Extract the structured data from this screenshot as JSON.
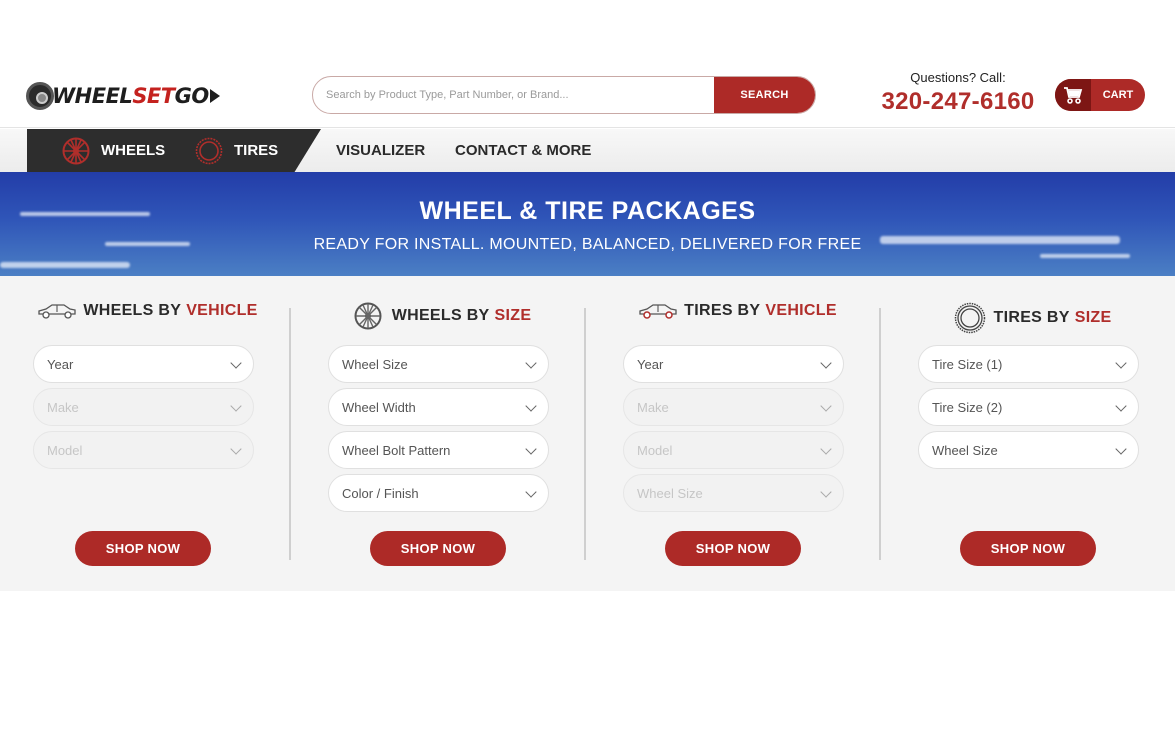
{
  "header": {
    "logo": {
      "part1": "WHEEL",
      "part2": "SET",
      "part3": "GO"
    },
    "search": {
      "placeholder": "Search by Product Type, Part Number, or Brand...",
      "button_label": "SEARCH"
    },
    "contact": {
      "question": "Questions? Call:",
      "phone": "320-247-6160"
    },
    "cart": {
      "label": "CART",
      "icon": "cart-icon"
    }
  },
  "nav": {
    "items": [
      {
        "label": "WHEELS",
        "icon": "wheel-icon"
      },
      {
        "label": "TIRES",
        "icon": "tire-icon"
      },
      {
        "label": "VISUALIZER"
      },
      {
        "label": "CONTACT & MORE"
      }
    ]
  },
  "hero": {
    "title": "WHEEL & TIRE PACKAGES",
    "subtitle": "READY FOR INSTALL. MOUNTED, BALANCED, DELIVERED FOR FREE"
  },
  "finder": {
    "columns": [
      {
        "title_main": "WHEELS BY",
        "title_accent": "VEHICLE",
        "icon": "car-icon",
        "selects": [
          {
            "label": "Year",
            "disabled": false
          },
          {
            "label": "Make",
            "disabled": true
          },
          {
            "label": "Model",
            "disabled": true
          }
        ],
        "button_label": "SHOP NOW"
      },
      {
        "title_main": "WHEELS BY",
        "title_accent": "SIZE",
        "icon": "wheel-icon",
        "selects": [
          {
            "label": "Wheel Size",
            "disabled": false
          },
          {
            "label": "Wheel Width",
            "disabled": false
          },
          {
            "label": "Wheel Bolt Pattern",
            "disabled": false
          },
          {
            "label": "Color / Finish",
            "disabled": false
          }
        ],
        "button_label": "SHOP NOW"
      },
      {
        "title_main": "TIRES BY",
        "title_accent": "VEHICLE",
        "icon": "car-icon",
        "selects": [
          {
            "label": "Year",
            "disabled": false
          },
          {
            "label": "Make",
            "disabled": true
          },
          {
            "label": "Model",
            "disabled": true
          },
          {
            "label": "Wheel Size",
            "disabled": true
          }
        ],
        "button_label": "SHOP NOW"
      },
      {
        "title_main": "TIRES BY",
        "title_accent": "SIZE",
        "icon": "tire-icon",
        "selects": [
          {
            "label": "Tire Size (1)",
            "disabled": false
          },
          {
            "label": "Tire Size (2)",
            "disabled": false
          },
          {
            "label": "Wheel Size",
            "disabled": false
          }
        ],
        "button_label": "SHOP NOW"
      }
    ]
  },
  "colors": {
    "brand_red": "#ad2a27",
    "dark_red": "#7d1614",
    "nav_dark": "#2d2d2d",
    "accent_text": "#b02e2b"
  }
}
